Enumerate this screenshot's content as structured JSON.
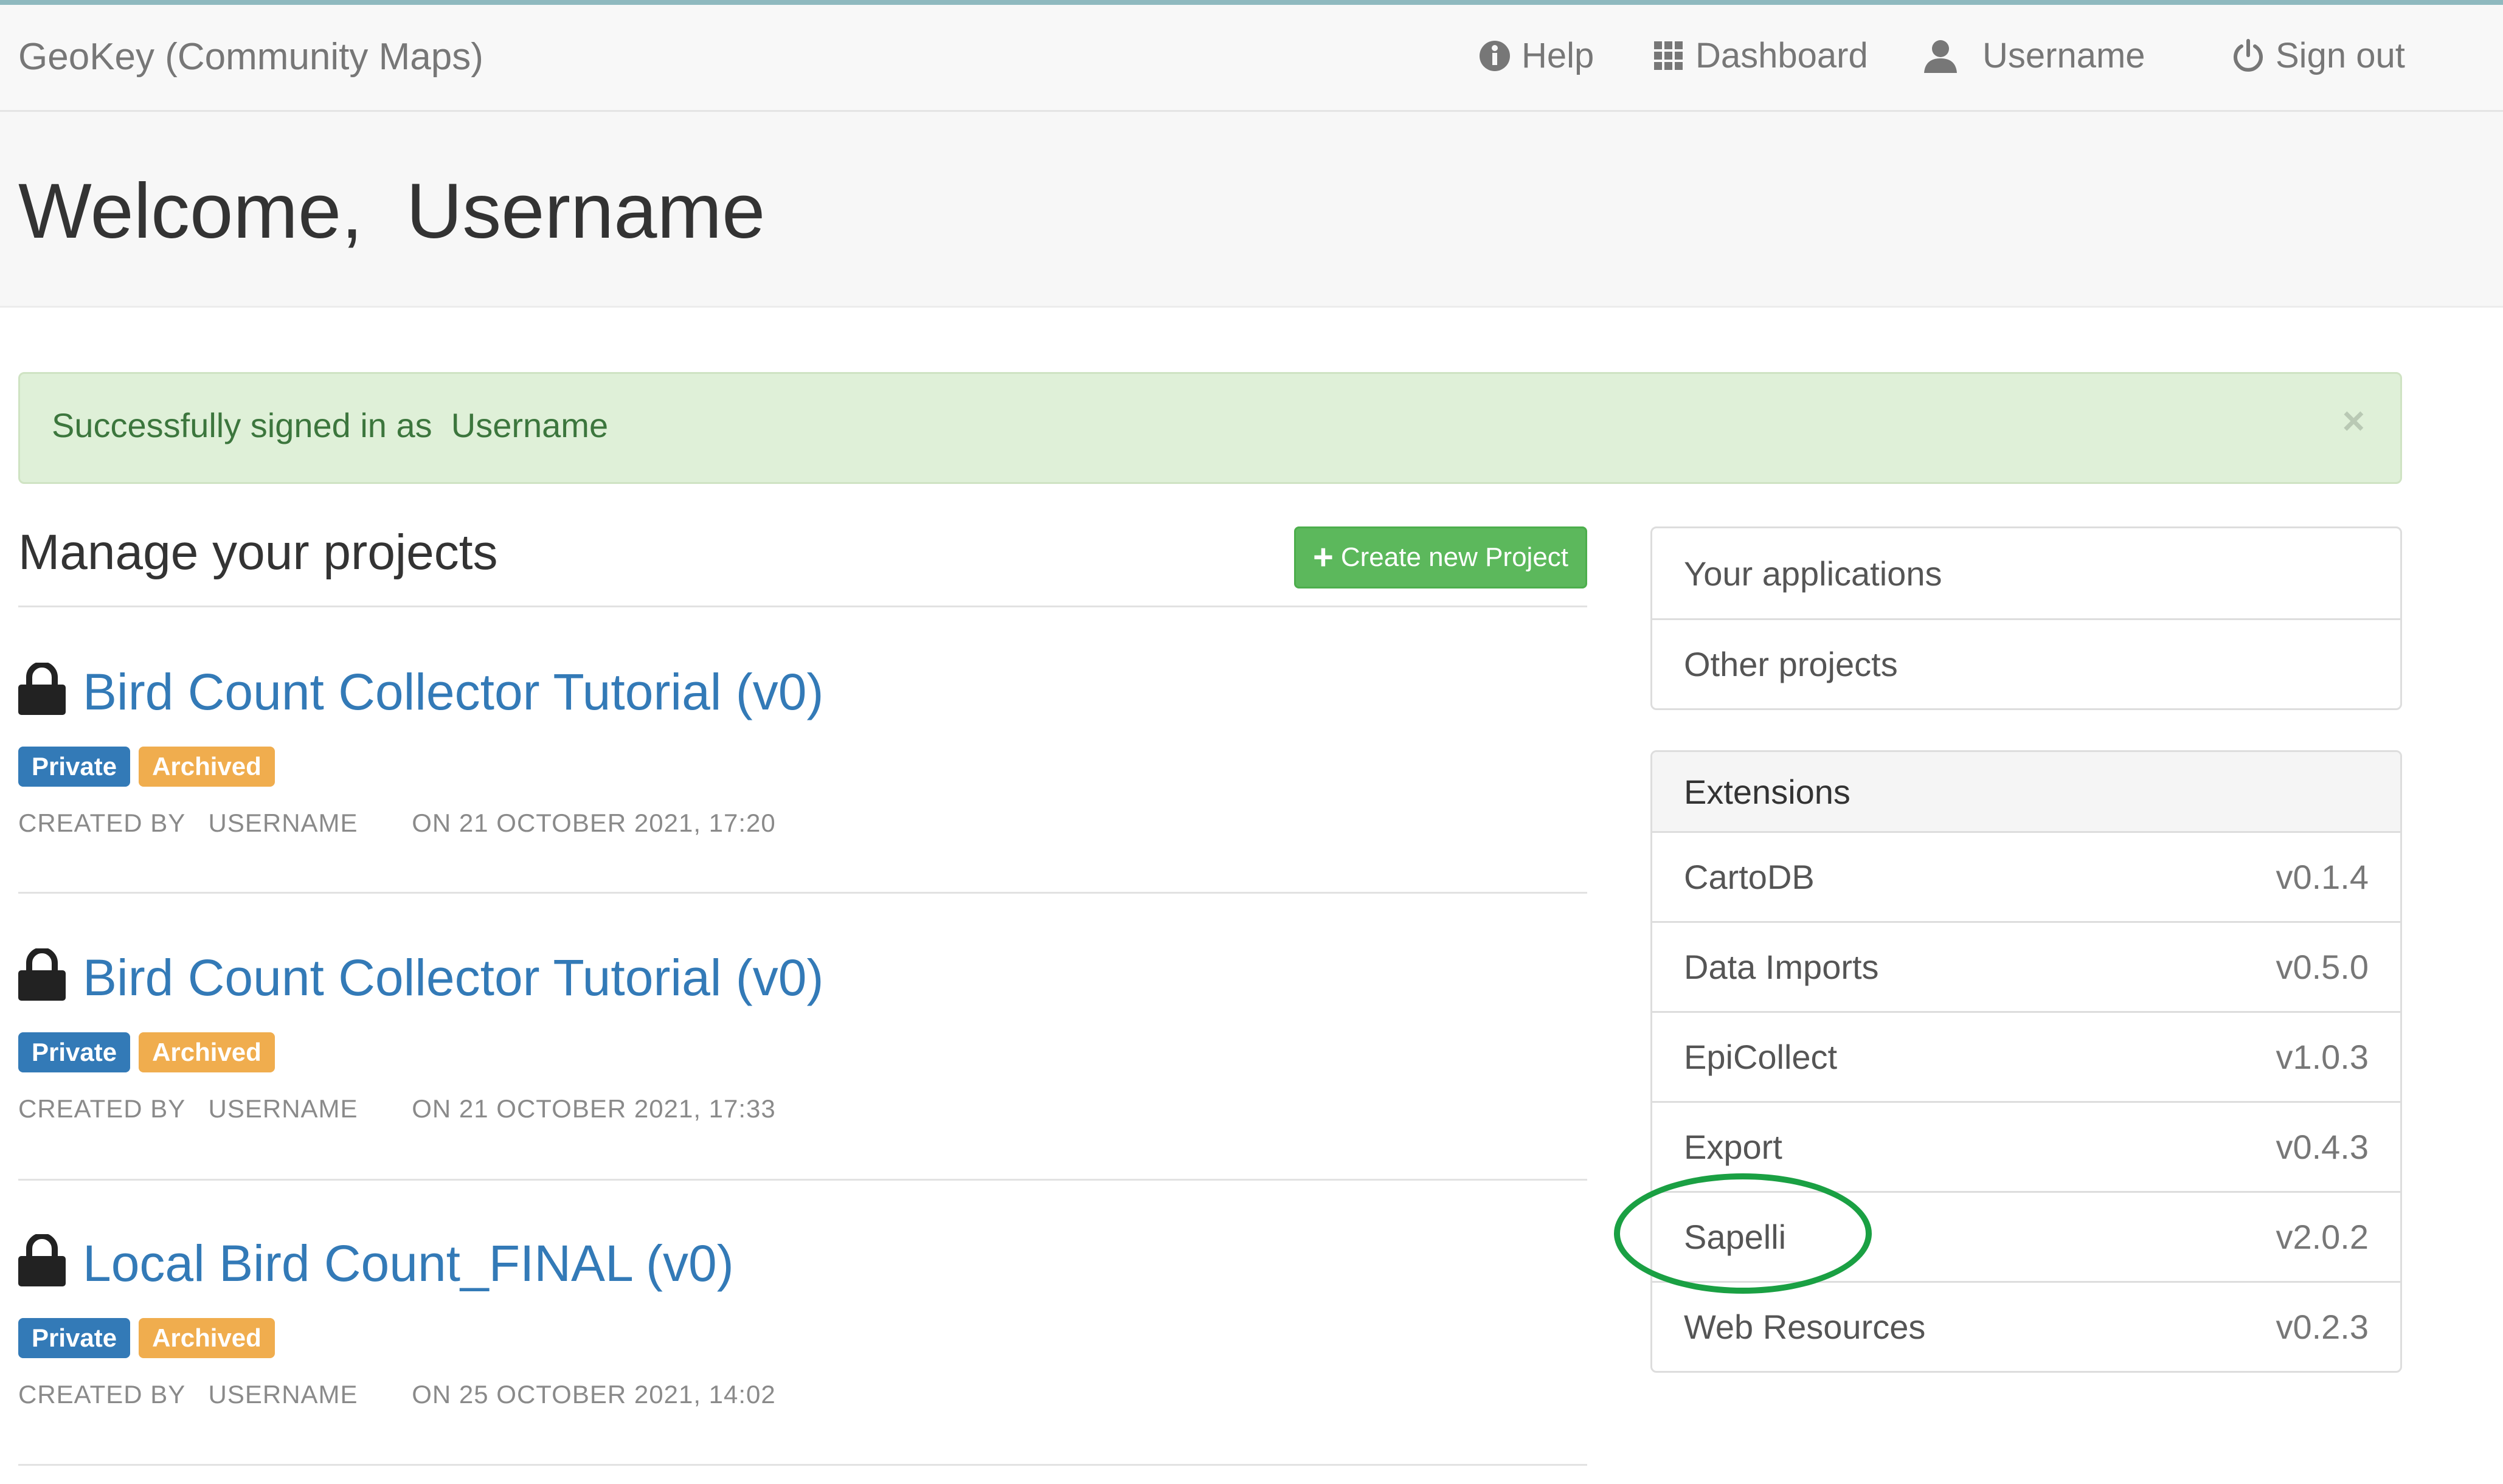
{
  "navbar": {
    "brand": "GeoKey (Community Maps)",
    "help": "Help",
    "dashboard": "Dashboard",
    "username": "Username",
    "sign_out": "Sign out"
  },
  "jumbotron": {
    "welcome": "Welcome,  Username"
  },
  "alert": {
    "message": "Successfully signed in as  Username",
    "close": "×"
  },
  "projects_section": {
    "title": "Manage your projects",
    "create_button": "Create new Project",
    "projects": [
      {
        "title": "Bird Count Collector Tutorial (v0)",
        "badge_private": "Private",
        "badge_archived": "Archived",
        "meta": "CREATED BY   USERNAME       ON 21 OCTOBER 2021, 17:20"
      },
      {
        "title": "Bird Count Collector Tutorial (v0)",
        "badge_private": "Private",
        "badge_archived": "Archived",
        "meta": "CREATED BY   USERNAME       ON 21 OCTOBER 2021, 17:33"
      },
      {
        "title": "Local Bird Count_FINAL (v0)",
        "badge_private": "Private",
        "badge_archived": "Archived",
        "meta": "CREATED BY   USERNAME       ON 25 OCTOBER 2021, 14:02"
      }
    ]
  },
  "side_links": [
    {
      "label": "Your applications"
    },
    {
      "label": "Other projects"
    }
  ],
  "extensions": {
    "heading": "Extensions",
    "items": [
      {
        "name": "CartoDB",
        "version": "v0.1.4"
      },
      {
        "name": "Data Imports",
        "version": "v0.5.0"
      },
      {
        "name": "EpiCollect",
        "version": "v1.0.3"
      },
      {
        "name": "Export",
        "version": "v0.4.3"
      },
      {
        "name": "Sapelli",
        "version": "v2.0.2"
      },
      {
        "name": "Web Resources",
        "version": "v0.2.3"
      }
    ]
  },
  "colors": {
    "link_blue": "#337ab7",
    "success_green": "#5cb85c",
    "warning_orange": "#f0ad4e",
    "alert_bg": "#dff0d8",
    "annotation_circle": "#1aa043"
  }
}
